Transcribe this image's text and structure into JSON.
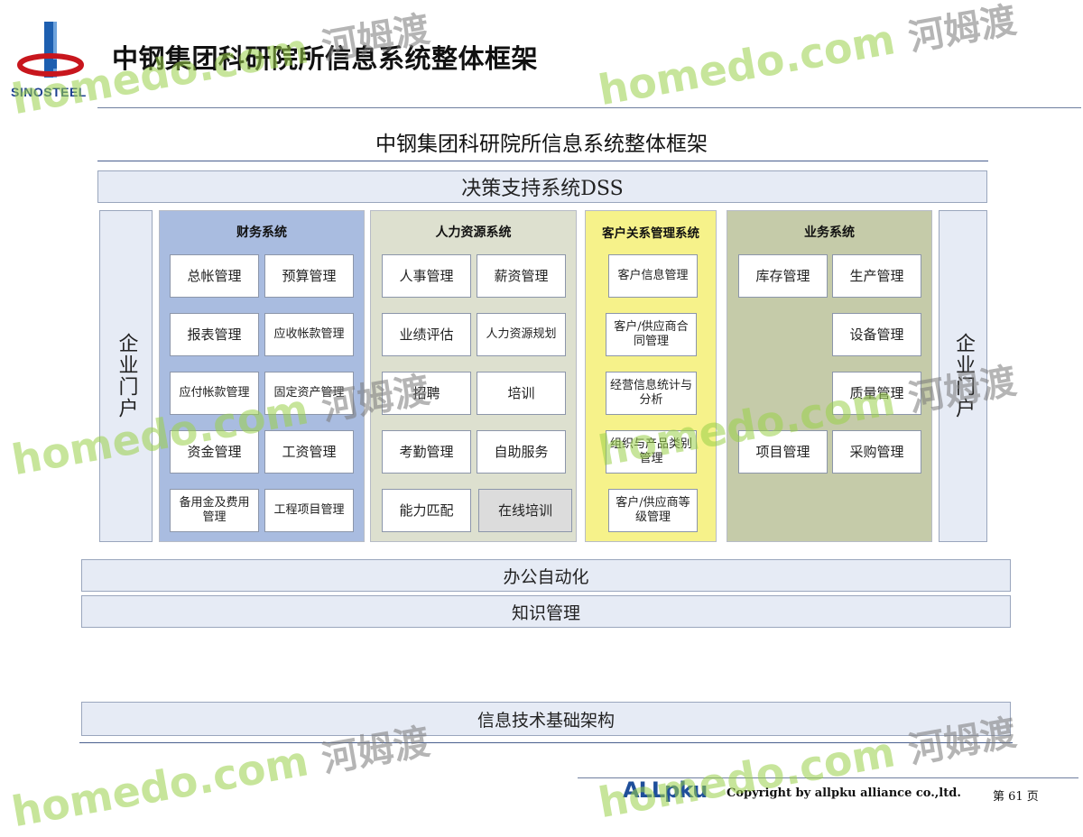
{
  "header": {
    "title": "中钢集团科研院所信息系统整体框架",
    "logo_text": "SINOSTEEL"
  },
  "diagram": {
    "subtitle": "中钢集团科研院所信息系统整体框架",
    "dss": "决策支持系统DSS",
    "portal_left": "企业门户",
    "portal_right": "企业门户",
    "office": "办公自动化",
    "knowledge": "知识管理",
    "infrastructure": "信息技术基础架构",
    "finance": {
      "title": "财务系统",
      "items": [
        "总帐管理",
        "预算管理",
        "报表管理",
        "应收帐款管理",
        "应付帐款管理",
        "固定资产管理",
        "资金管理",
        "工资管理",
        "备用金及费用管理",
        "工程项目管理"
      ]
    },
    "hr": {
      "title": "人力资源系统",
      "items": [
        "人事管理",
        "薪资管理",
        "业绩评估",
        "人力资源规划",
        "招聘",
        "培训",
        "考勤管理",
        "自助服务",
        "能力匹配",
        "在线培训"
      ]
    },
    "crm": {
      "title": "客户关系管理系统",
      "items": [
        "客户信息管理",
        "客户/供应商合同管理",
        "经营信息统计与分析",
        "组织与产品类别管理",
        "客户/供应商等级管理"
      ]
    },
    "business": {
      "title": "业务系统",
      "items": [
        "库存管理",
        "生产管理",
        "设备管理",
        "质量管理",
        "项目管理",
        "采购管理"
      ]
    }
  },
  "footer": {
    "brand": "ALLpku",
    "copyright": "Copyright by  allpku alliance co.,ltd.",
    "page": "第 61 页"
  },
  "watermark": {
    "text": "homedo.com",
    "han": "河姆渡"
  },
  "colors": {
    "finance_bg": "#a9bce0",
    "hr_bg": "#dde0cf",
    "crm_bg": "#f6f28a",
    "business_bg": "#c5cba9",
    "band_bg": "#e6ebf5"
  }
}
